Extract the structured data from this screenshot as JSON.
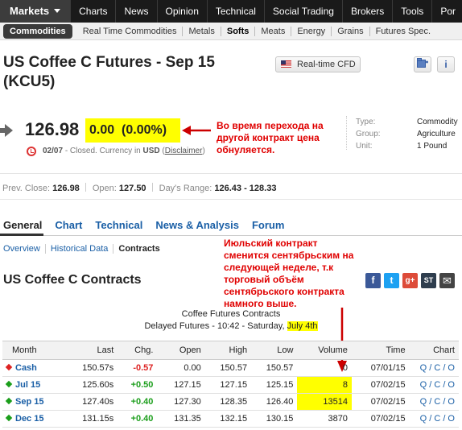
{
  "topnav": {
    "items": [
      {
        "label": "Markets"
      },
      {
        "label": "Charts"
      },
      {
        "label": "News"
      },
      {
        "label": "Opinion"
      },
      {
        "label": "Technical"
      },
      {
        "label": "Social Trading"
      },
      {
        "label": "Brokers"
      },
      {
        "label": "Tools"
      },
      {
        "label": "Por"
      }
    ]
  },
  "subnav": {
    "items": [
      {
        "label": "Commodities"
      },
      {
        "label": "Real Time Commodities"
      },
      {
        "label": "Metals"
      },
      {
        "label": "Softs"
      },
      {
        "label": "Meats"
      },
      {
        "label": "Energy"
      },
      {
        "label": "Grains"
      },
      {
        "label": "Futures Spec."
      }
    ]
  },
  "header": {
    "title_line1": "US Coffee C Futures - Sep 15",
    "title_line2": "(KCU5)",
    "realtime_button": "Real-time CFD",
    "info_button": "i"
  },
  "quote": {
    "price": "126.98",
    "change": "0.00",
    "change_pct": "(0.00%)",
    "date": "02/07",
    "status": "- Closed. Currency in",
    "currency": "USD",
    "disclaimer_open": "(",
    "disclaimer": "Disclaimer",
    "disclaimer_close": ")"
  },
  "annotations": {
    "top": [
      "Во время перехода на",
      "другой контракт цена",
      "обнуляется."
    ],
    "middle": [
      "Июльский контракт",
      "сменится сентябрьским на",
      "следующей неделе, т.к",
      "торговый объём",
      "сентябрьского контракта",
      "намного выше."
    ]
  },
  "info": {
    "type_label": "Type:",
    "type_value": "Commodity",
    "group_label": "Group:",
    "group_value": "Agriculture",
    "unit_label": "Unit:",
    "unit_value": "1 Pound"
  },
  "stats": {
    "prev_close_label": "Prev. Close:",
    "prev_close": "126.98",
    "open_label": "Open:",
    "open": "127.50",
    "range_label": "Day's Range:",
    "range": "126.43 - 128.33"
  },
  "tabs": [
    {
      "label": "General"
    },
    {
      "label": "Chart"
    },
    {
      "label": "Technical"
    },
    {
      "label": "News & Analysis"
    },
    {
      "label": "Forum"
    }
  ],
  "subtabs": [
    {
      "label": "Overview"
    },
    {
      "label": "Historical Data"
    },
    {
      "label": "Contracts"
    }
  ],
  "contracts": {
    "heading": "US Coffee C Contracts",
    "caption1": "Coffee Futures Contracts",
    "caption2": "Delayed Futures - 10:42 - Saturday,",
    "caption2_date": "July 4th",
    "columns": [
      "Month",
      "Last",
      "Chg.",
      "Open",
      "High",
      "Low",
      "Volume",
      "Time",
      "Chart"
    ],
    "rows": [
      {
        "month": "Cash",
        "last": "150.57s",
        "chg": "-0.57",
        "open": "0.00",
        "high": "150.57",
        "low": "150.57",
        "volume": "0",
        "time": "07/01/15",
        "chart": "Q / C / O",
        "dir": "down"
      },
      {
        "month": "Jul 15",
        "last": "125.60s",
        "chg": "+0.50",
        "open": "127.15",
        "high": "127.15",
        "low": "125.15",
        "volume": "8",
        "time": "07/02/15",
        "chart": "Q / C / O",
        "dir": "up"
      },
      {
        "month": "Sep 15",
        "last": "127.40s",
        "chg": "+0.40",
        "open": "127.30",
        "high": "128.35",
        "low": "126.40",
        "volume": "13514",
        "time": "07/02/15",
        "chart": "Q / C / O",
        "dir": "up"
      },
      {
        "month": "Dec 15",
        "last": "131.15s",
        "chg": "+0.40",
        "open": "131.35",
        "high": "132.15",
        "low": "130.15",
        "volume": "3870",
        "time": "07/02/15",
        "chart": "Q / C / O",
        "dir": "up"
      }
    ]
  },
  "share": {
    "facebook": "f",
    "twitter": "t",
    "gplus": "g+",
    "stocktwits": "ST",
    "email": "✉"
  },
  "colors": {
    "highlight": "#ffff00",
    "annotation": "#e00000",
    "link": "#1a5fa6",
    "positive": "#1b9e1b",
    "negative": "#d22222"
  }
}
